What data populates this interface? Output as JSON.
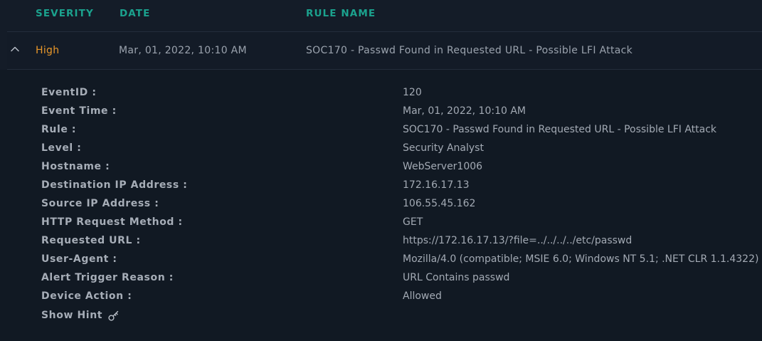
{
  "table": {
    "headers": {
      "severity": "SEVERITY",
      "date": "DATE",
      "rule_name": "RULE NAME"
    },
    "row": {
      "severity": "High",
      "date": "Mar, 01, 2022, 10:10 AM",
      "rule_name": "SOC170 - Passwd Found in Requested URL - Possible LFI Attack",
      "expand_icon": "chevron-up-icon"
    }
  },
  "details": [
    {
      "label": "EventID :",
      "value": "120"
    },
    {
      "label": "Event Time :",
      "value": "Mar, 01, 2022, 10:10 AM"
    },
    {
      "label": "Rule :",
      "value": "SOC170 - Passwd Found in Requested URL - Possible LFI Attack"
    },
    {
      "label": "Level :",
      "value": "Security Analyst"
    },
    {
      "label": "Hostname :",
      "value": "WebServer1006"
    },
    {
      "label": "Destination IP Address :",
      "value": "172.16.17.13"
    },
    {
      "label": "Source IP Address :",
      "value": "106.55.45.162"
    },
    {
      "label": "HTTP Request Method :",
      "value": "GET"
    },
    {
      "label": "Requested URL :",
      "value": "https://172.16.17.13/?file=../../../../etc/passwd"
    },
    {
      "label": "User-Agent :",
      "value": "Mozilla/4.0 (compatible; MSIE 6.0; Windows NT 5.1; .NET CLR 1.1.4322)"
    },
    {
      "label": "Alert Trigger Reason :",
      "value": "URL Contains passwd"
    },
    {
      "label": "Device Action :",
      "value": "Allowed"
    }
  ],
  "hint": {
    "label": "Show Hint",
    "icon": "key-icon"
  },
  "colors": {
    "background": "#141c28",
    "header_accent": "#1ba28e",
    "severity_high": "#e8972a",
    "text_muted": "#9ba3ae"
  }
}
